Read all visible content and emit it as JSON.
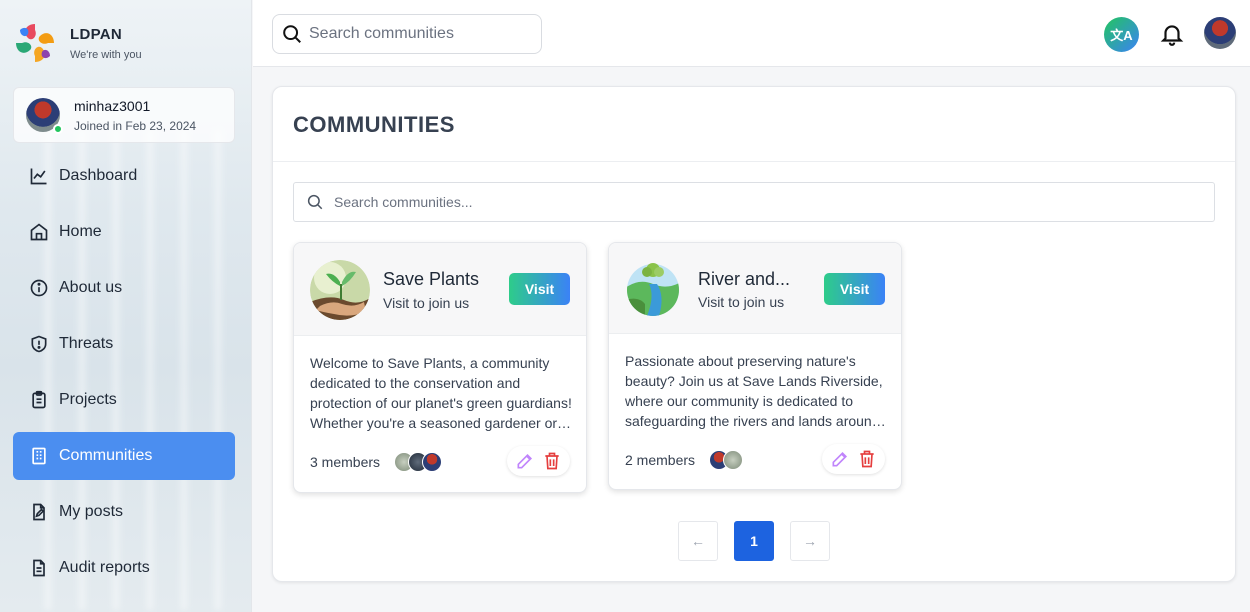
{
  "brand": {
    "name": "LDPAN",
    "tagline": "We're with you"
  },
  "user": {
    "username": "minhaz3001",
    "joined": "Joined in Feb 23, 2024"
  },
  "nav": [
    {
      "label": "Dashboard",
      "icon": "chart-line-icon",
      "active": false
    },
    {
      "label": "Home",
      "icon": "home-icon",
      "active": false
    },
    {
      "label": "About us",
      "icon": "info-icon",
      "active": false
    },
    {
      "label": "Threats",
      "icon": "shield-alert-icon",
      "active": false
    },
    {
      "label": "Projects",
      "icon": "clipboard-icon",
      "active": false
    },
    {
      "label": "Communities",
      "icon": "building-icon",
      "active": true
    },
    {
      "label": "My posts",
      "icon": "file-edit-icon",
      "active": false
    },
    {
      "label": "Audit reports",
      "icon": "file-text-icon",
      "active": false
    }
  ],
  "topbar": {
    "search_placeholder": "Search communities",
    "translate_label": "文A"
  },
  "page": {
    "title": "COMMUNITIES",
    "search_placeholder": "Search communities..."
  },
  "communities": [
    {
      "name": "Save Plants",
      "subtitle": "Visit to join us",
      "visit_label": "Visit",
      "description": "Welcome to Save Plants, a community dedicated to the conservation and protection of our planet's green guardians! Whether you're a seasoned gardener or just starting out, join us.",
      "members": "3 members"
    },
    {
      "name": "River and...",
      "subtitle": "Visit to join us",
      "visit_label": "Visit",
      "description": "Passionate about preserving nature's beauty? Join us at Save Lands Riverside, where our community is dedicated to safeguarding the rivers and lands around us.",
      "members": "2 members"
    }
  ],
  "pagination": {
    "prev": "←",
    "current": "1",
    "next": "→"
  },
  "colors": {
    "accent": "#4b8ef0",
    "primary": "#1d63e0",
    "edit": "#c084fc",
    "delete": "#e53e3e"
  }
}
